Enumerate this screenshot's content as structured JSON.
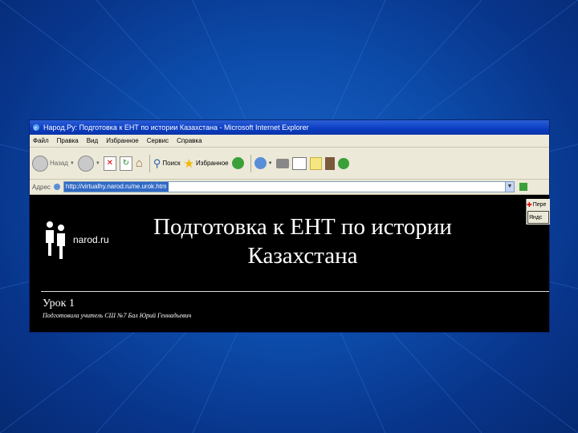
{
  "window": {
    "title": "Народ.Ру: Подготовка к ЕНТ по истории Казахстана - Microsoft Internet Explorer"
  },
  "menu": [
    "Файл",
    "Правка",
    "Вид",
    "Избранное",
    "Сервис",
    "Справка"
  ],
  "toolbar": {
    "back_label": "Назад",
    "search_label": "Поиск",
    "favorites_label": "Избранное"
  },
  "address": {
    "label": "Адрес",
    "url": "http://virtualhy.narod.ru/ne.urok.htm"
  },
  "side": {
    "top": "Пере",
    "bottom": "Яндс"
  },
  "page": {
    "logo": "narod.ru",
    "heading_line1": "Подготовка к ЕНТ по истории",
    "heading_line2": "Казахстана",
    "lesson": "Урок 1",
    "author": "Подготовила учитель СШ №7 Бал Юрий Геннадьевич"
  },
  "colors": {
    "slide_background": "#0c4aa8",
    "titlebar": "#0a3cc0",
    "content_background": "#000000"
  }
}
